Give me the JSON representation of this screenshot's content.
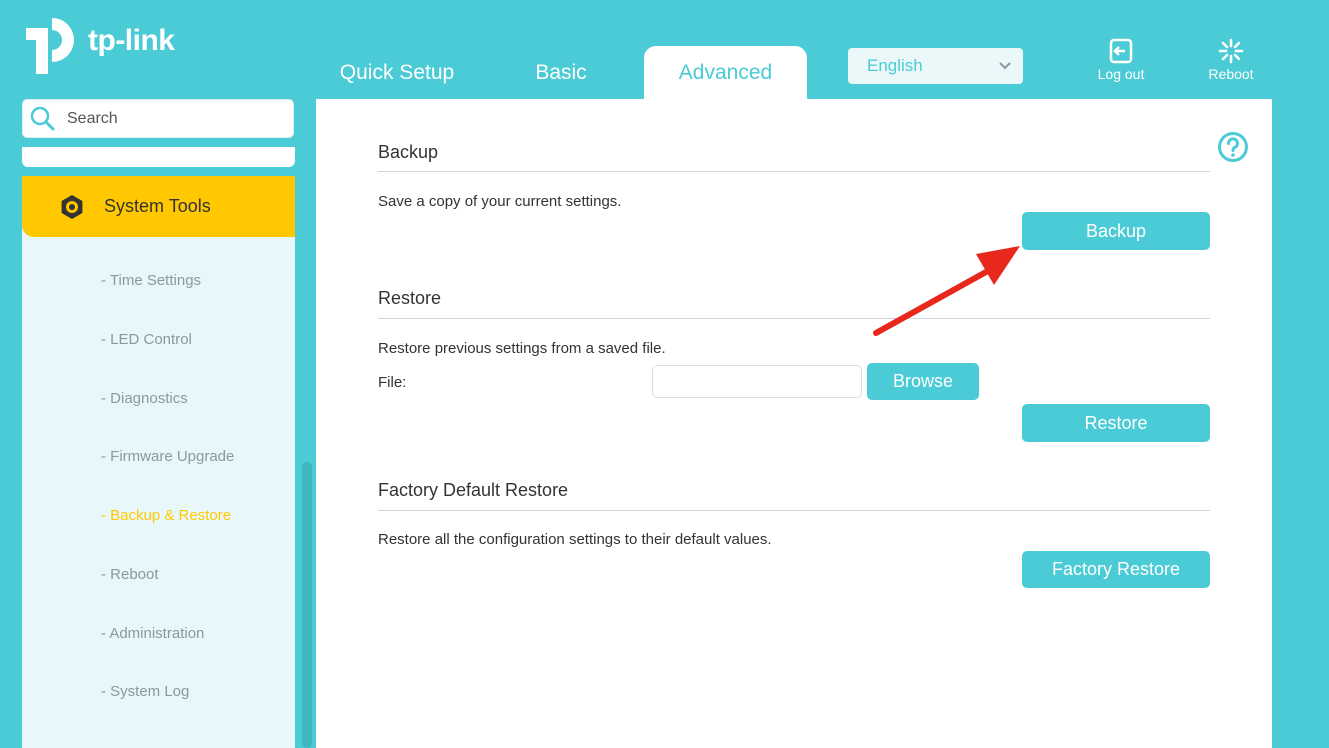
{
  "brand": {
    "name": "tp-link"
  },
  "nav": {
    "tabs": [
      {
        "label": "Quick Setup"
      },
      {
        "label": "Basic"
      },
      {
        "label": "Advanced",
        "active": true
      }
    ],
    "language": {
      "selected": "English"
    },
    "actions": {
      "logout": "Log out",
      "reboot": "Reboot"
    }
  },
  "sidebar": {
    "search_placeholder": "Search",
    "active_section": "System Tools",
    "items": [
      {
        "label": "- Time Settings"
      },
      {
        "label": "- LED Control"
      },
      {
        "label": "- Diagnostics"
      },
      {
        "label": "- Firmware Upgrade"
      },
      {
        "label": "- Backup & Restore",
        "current": true
      },
      {
        "label": "- Reboot"
      },
      {
        "label": "- Administration"
      },
      {
        "label": "- System Log"
      }
    ]
  },
  "backup": {
    "title": "Backup",
    "description": "Save a copy of your current settings.",
    "button": "Backup"
  },
  "restore": {
    "title": "Restore",
    "description": "Restore previous settings from a saved file.",
    "file_label": "File:",
    "file_value": "",
    "browse_button": "Browse",
    "button": "Restore"
  },
  "factory": {
    "title": "Factory Default Restore",
    "description": "Restore all the configuration settings to their default values.",
    "button": "Factory Restore"
  },
  "colors": {
    "accent": "#4acbd6",
    "highlight": "#ffc800",
    "annotation_arrow": "#e8281c"
  }
}
